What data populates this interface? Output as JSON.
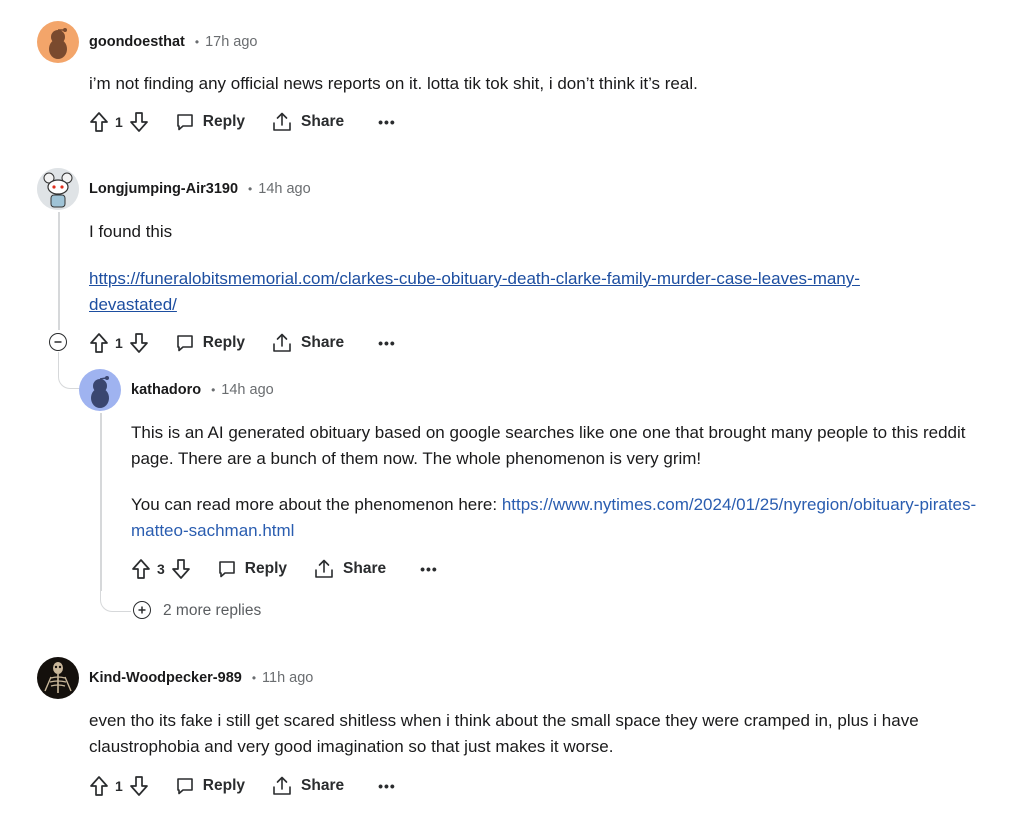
{
  "actions": {
    "reply": "Reply",
    "share": "Share",
    "more": "•••"
  },
  "comments": [
    {
      "user": "goondoesthat",
      "time": "17h ago",
      "body": "i’m not finding any official news reports on it. lotta tik tok shit, i don’t think it’s real.",
      "votes": "1"
    },
    {
      "user": "Longjumping-Air3190",
      "time": "14h ago",
      "body": "I found this",
      "link": "https://funeralobitsmemorial.com/clarkes-cube-obituary-death-clarke-family-murder-case-leaves-many-devastated/",
      "link_line1": "https://funeralobitsmemorial.com/clarkes-cube-obituary-death-clarke-family-murder-case-leaves-many-",
      "link_line2": "devastated/",
      "votes": "1"
    },
    {
      "user": "kathadoro",
      "time": "14h ago",
      "body1": "This is an AI generated obituary based on google searches like one one that brought many people to this reddit page. There are a bunch of them now. The whole phenomenon is very grim!",
      "body2_prefix": "You can read more about the phenomenon here: ",
      "link": "https://www.nytimes.com/2024/01/25/nyregion/obituary-pirates-matteo-sachman.html",
      "votes": "3",
      "more_replies": "2 more replies"
    },
    {
      "user": "Kind-Woodpecker-989",
      "time": "11h ago",
      "body": "even tho its fake i still get scared shitless when i think about the small space they were cramped in, plus i have claustrophobia and very good imagination so that just makes it worse.",
      "votes": "1"
    }
  ]
}
